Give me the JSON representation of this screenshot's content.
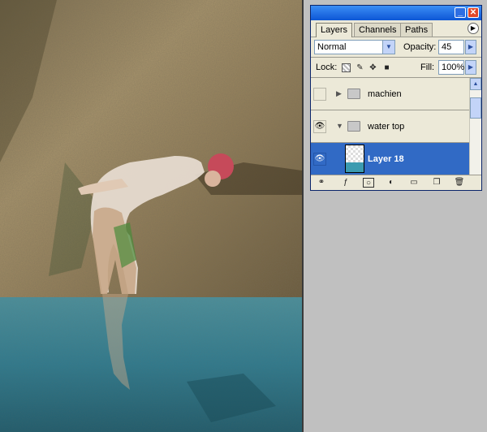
{
  "palette": {
    "tabs": [
      {
        "label": "Layers",
        "active": true
      },
      {
        "label": "Channels",
        "active": false
      },
      {
        "label": "Paths",
        "active": false
      }
    ],
    "blend_mode": "Normal",
    "opacity_label": "Opacity:",
    "opacity_value": "45",
    "lock_label": "Lock:",
    "fill_label": "Fill:",
    "fill_value": "100%",
    "layers": [
      {
        "name": "machien",
        "type": "group",
        "visible": false,
        "expanded": false,
        "selected": false
      },
      {
        "name": "water top",
        "type": "group",
        "visible": true,
        "expanded": true,
        "selected": false
      },
      {
        "name": "Layer 18",
        "type": "layer",
        "visible": true,
        "selected": true
      }
    ]
  },
  "colors": {
    "selection": "#316ac5",
    "title_bar": "#0c56d6",
    "water": "#3c8fa6",
    "rock": "#8d7a57"
  }
}
